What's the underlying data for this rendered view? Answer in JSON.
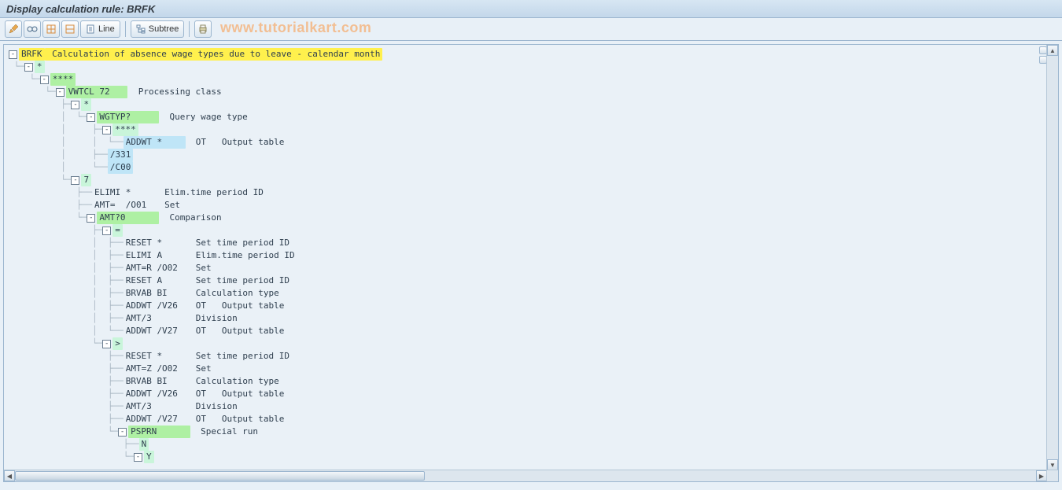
{
  "title": "Display calculation rule: BRFK",
  "watermark": "www.tutorialkart.com",
  "toolbar": {
    "line_label": "Line",
    "subtree_label": "Subtree"
  },
  "tree": [
    {
      "indent": 0,
      "toggle": "-",
      "code": "BRFK",
      "code_cls": "yellow",
      "desc": "Calculation of absence wage types due to leave - calendar month",
      "desc_cls": "yellow"
    },
    {
      "indent": 1,
      "toggle": "-",
      "code": "*",
      "code_cls": "mint"
    },
    {
      "indent": 2,
      "toggle": "-",
      "code": "****",
      "code_cls": "green"
    },
    {
      "indent": 3,
      "toggle": "-",
      "code": "VWTCL 72",
      "code_cls": "green",
      "desc": "Processing class"
    },
    {
      "indent": 4,
      "toggle": "-",
      "code": "*",
      "code_cls": "mint"
    },
    {
      "indent": 5,
      "toggle": "-",
      "code": "WGTYP?",
      "code_cls": "green",
      "desc": "Query wage type"
    },
    {
      "indent": 6,
      "toggle": "-",
      "code": "****",
      "code_cls": "mint"
    },
    {
      "indent": 7,
      "toggle": "",
      "code": "ADDWT *",
      "code_cls": "blue",
      "desc": "OT   Output table"
    },
    {
      "indent": 6,
      "toggle": "",
      "code": "/331",
      "code_cls": "blue"
    },
    {
      "indent": 6,
      "toggle": "",
      "code": "/C00",
      "code_cls": "blue"
    },
    {
      "indent": 4,
      "toggle": "-",
      "code": "7",
      "code_cls": "mint"
    },
    {
      "indent": 5,
      "toggle": "",
      "code": "ELIMI *",
      "code_cls": "plain",
      "desc": "Elim.time period ID"
    },
    {
      "indent": 5,
      "toggle": "",
      "code": "AMT=  /O01",
      "code_cls": "plain",
      "desc": "Set"
    },
    {
      "indent": 5,
      "toggle": "-",
      "code": "AMT?0",
      "code_cls": "green",
      "desc": "Comparison"
    },
    {
      "indent": 6,
      "toggle": "-",
      "code": "=",
      "code_cls": "mint"
    },
    {
      "indent": 7,
      "toggle": "",
      "code": "RESET *",
      "code_cls": "plain",
      "desc": "Set time period ID"
    },
    {
      "indent": 7,
      "toggle": "",
      "code": "ELIMI A",
      "code_cls": "plain",
      "desc": "Elim.time period ID"
    },
    {
      "indent": 7,
      "toggle": "",
      "code": "AMT=R /O02",
      "code_cls": "plain",
      "desc": "Set"
    },
    {
      "indent": 7,
      "toggle": "",
      "code": "RESET A",
      "code_cls": "plain",
      "desc": "Set time period ID"
    },
    {
      "indent": 7,
      "toggle": "",
      "code": "BRVAB BI",
      "code_cls": "plain",
      "desc": "Calculation type"
    },
    {
      "indent": 7,
      "toggle": "",
      "code": "ADDWT /V26",
      "code_cls": "plain",
      "desc": "OT   Output table"
    },
    {
      "indent": 7,
      "toggle": "",
      "code": "AMT/3",
      "code_cls": "plain",
      "desc": "Division"
    },
    {
      "indent": 7,
      "toggle": "",
      "code": "ADDWT /V27",
      "code_cls": "plain",
      "desc": "OT   Output table"
    },
    {
      "indent": 6,
      "toggle": "-",
      "code": ">",
      "code_cls": "mint"
    },
    {
      "indent": 7,
      "toggle": "",
      "code": "RESET *",
      "code_cls": "plain",
      "desc": "Set time period ID"
    },
    {
      "indent": 7,
      "toggle": "",
      "code": "AMT=Z /O02",
      "code_cls": "plain",
      "desc": "Set"
    },
    {
      "indent": 7,
      "toggle": "",
      "code": "BRVAB BI",
      "code_cls": "plain",
      "desc": "Calculation type"
    },
    {
      "indent": 7,
      "toggle": "",
      "code": "ADDWT /V26",
      "code_cls": "plain",
      "desc": "OT   Output table"
    },
    {
      "indent": 7,
      "toggle": "",
      "code": "AMT/3",
      "code_cls": "plain",
      "desc": "Division"
    },
    {
      "indent": 7,
      "toggle": "",
      "code": "ADDWT /V27",
      "code_cls": "plain",
      "desc": "OT   Output table"
    },
    {
      "indent": 7,
      "toggle": "-",
      "code": "PSPRN",
      "code_cls": "green",
      "desc": "Special run"
    },
    {
      "indent": 8,
      "toggle": "",
      "code": "N",
      "code_cls": "mint"
    },
    {
      "indent": 8,
      "toggle": "-",
      "code": "Y",
      "code_cls": "mint"
    }
  ]
}
